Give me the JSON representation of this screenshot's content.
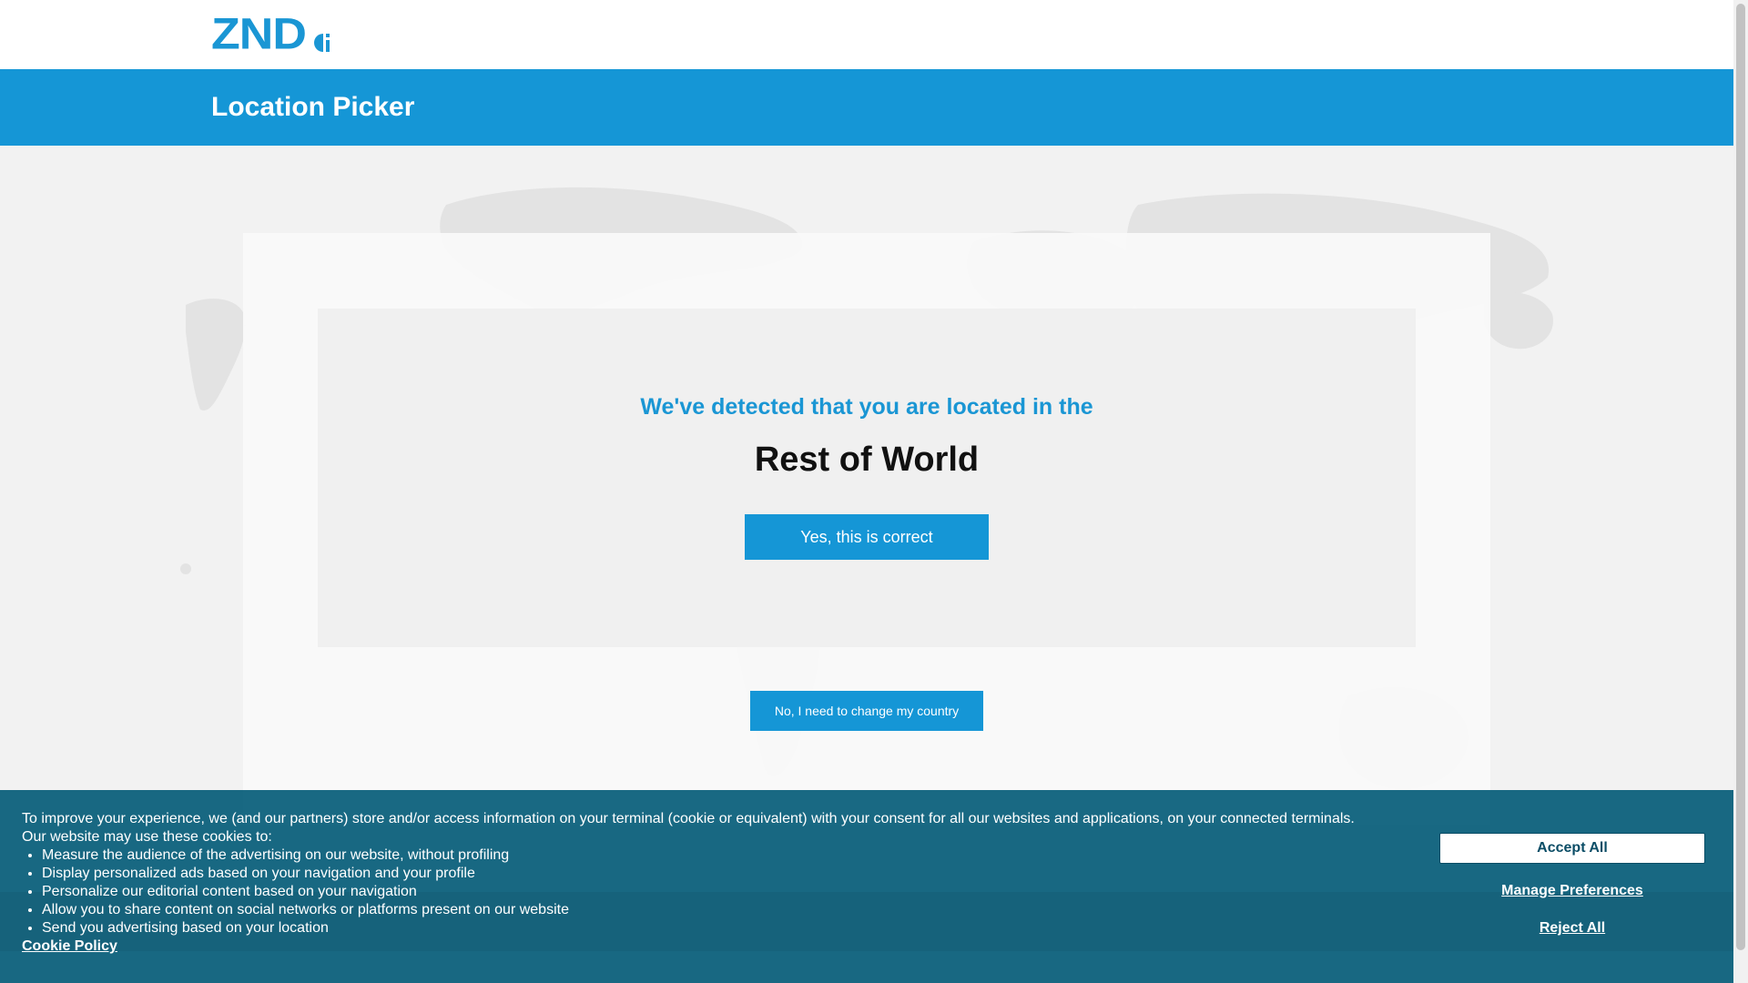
{
  "header": {
    "logo_text": "ZND"
  },
  "page": {
    "title": "Location Picker"
  },
  "location": {
    "detected_label": "We've detected that you are located in the",
    "country": "Rest of World",
    "confirm_label": "Yes, this is correct",
    "change_label": "No, I need to change my country"
  },
  "cookie_banner": {
    "intro": "To improve your experience, we (and our partners) store and/or access information on your terminal (cookie or equivalent) with your consent for all our websites and applications, on your connected terminals.",
    "uses_intro": "Our website may use these cookies to:",
    "uses": [
      "Measure the audience of the advertising on our website, without profiling",
      "Display personalized ads based on your navigation and your profile",
      "Personalize our editorial content based on your navigation",
      "Allow you to share content on social networks or platforms present on our website",
      "Send you advertising based on your location"
    ],
    "policy_link": "Cookie Policy",
    "accept_label": "Accept All",
    "manage_label": "Manage Preferences",
    "reject_label": "Reject All"
  },
  "colors": {
    "brand": "#1596d6",
    "banner": "#085e7a"
  }
}
